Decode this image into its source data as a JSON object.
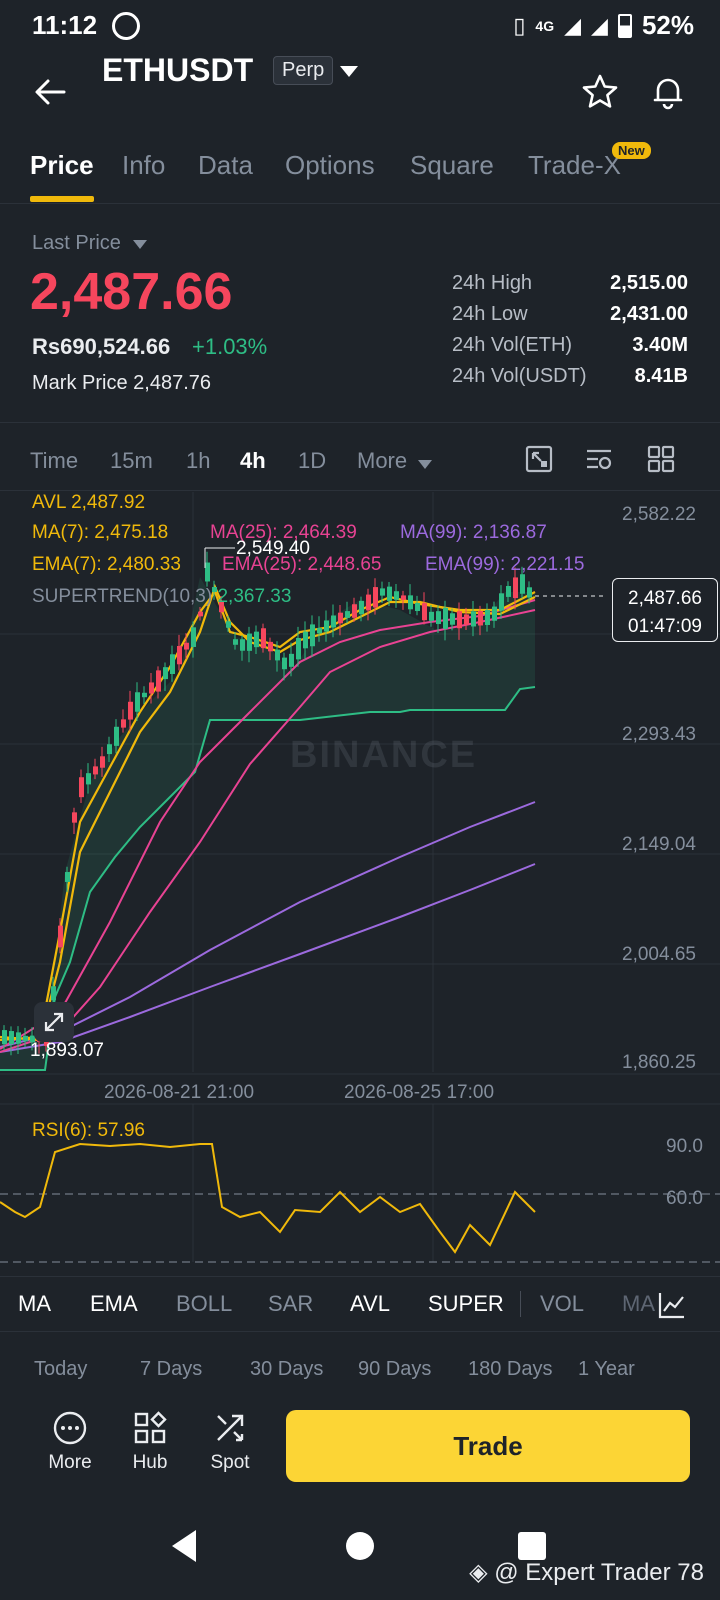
{
  "status": {
    "time": "11:12",
    "network": "4G",
    "battery": "52%"
  },
  "header": {
    "pair": "ETHUSDT",
    "badge": "Perp"
  },
  "tabs": [
    {
      "label": "Price"
    },
    {
      "label": "Info"
    },
    {
      "label": "Data"
    },
    {
      "label": "Options"
    },
    {
      "label": "Square"
    },
    {
      "label": "Trade-X"
    }
  ],
  "new_badge": "New",
  "price": {
    "label": "Last Price",
    "value": "2,487.66",
    "inr": "Rs690,524.66",
    "change": "+1.03%",
    "mark_label": "Mark Price",
    "mark_value": "2,487.76"
  },
  "stats": [
    {
      "k": "24h High",
      "v": "2,515.00"
    },
    {
      "k": "24h Low",
      "v": "2,431.00"
    },
    {
      "k": "24h Vol(ETH)",
      "v": "3.40M"
    },
    {
      "k": "24h Vol(USDT)",
      "v": "8.41B"
    }
  ],
  "timeframes": [
    {
      "label": "Time"
    },
    {
      "label": "15m"
    },
    {
      "label": "1h"
    },
    {
      "label": "4h"
    },
    {
      "label": "1D"
    },
    {
      "label": "More"
    }
  ],
  "legend": {
    "avl": "AVL 2,487.92",
    "ma7": "MA(7): 2,475.18",
    "ma25": "MA(25): 2,464.39",
    "ma99": "MA(99): 2,136.87",
    "ema7": "EMA(7): 2,480.33",
    "ema25": "EMA(25): 2,448.65",
    "ema99": "EMA(99): 2,221.15",
    "super_label": "SUPERTREND(10,3)",
    "super_value": "2,367.33"
  },
  "axis": {
    "y1": "2,582.22",
    "y2": "2,293.43",
    "y3": "2,149.04",
    "y4": "2,004.65",
    "y5": "1,860.25",
    "x1": "2026-08-21 21:00",
    "x2": "2026-08-25 17:00"
  },
  "markers": {
    "high": "2,549.40",
    "low": "1,893.07"
  },
  "price_tag": {
    "price": "2,487.66",
    "countdown": "01:47:09"
  },
  "brand_watermark": "BINANCE",
  "rsi": {
    "label": "RSI(6): 57.96",
    "y1": "90.0",
    "y2": "60.0"
  },
  "indicators": [
    {
      "label": "MA"
    },
    {
      "label": "EMA"
    },
    {
      "label": "BOLL"
    },
    {
      "label": "SAR"
    },
    {
      "label": "AVL"
    },
    {
      "label": "SUPER"
    },
    {
      "label": "VOL"
    },
    {
      "label": "MA"
    }
  ],
  "ranges": [
    {
      "label": "Today"
    },
    {
      "label": "7 Days"
    },
    {
      "label": "30 Days"
    },
    {
      "label": "90 Days"
    },
    {
      "label": "180 Days"
    },
    {
      "label": "1 Year"
    }
  ],
  "actions": {
    "more": "More",
    "hub": "Hub",
    "spot": "Spot",
    "trade": "Trade"
  },
  "watermark": "@ Expert Trader 78",
  "colors": {
    "up": "#2ebd85",
    "down": "#f6465d",
    "accent": "#fcd535",
    "bg": "#1e2329"
  }
}
